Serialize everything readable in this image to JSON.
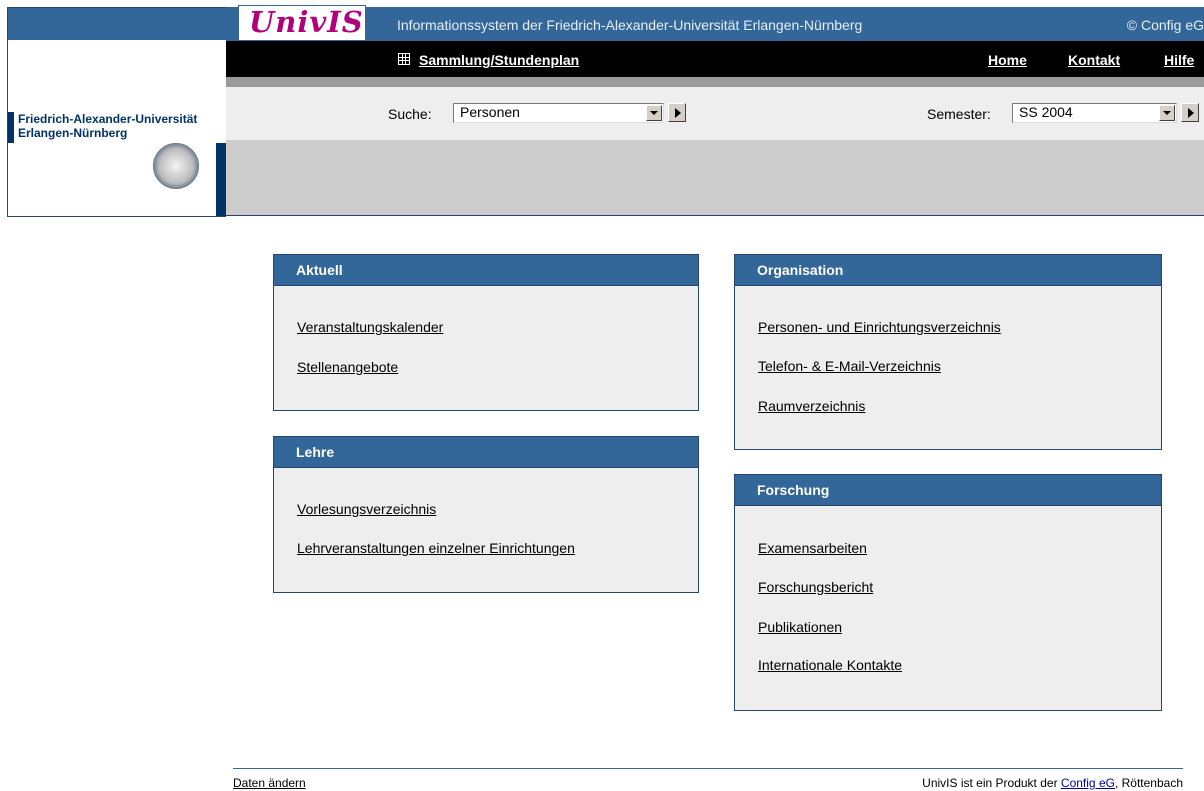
{
  "header": {
    "logo_text": "UnivIS",
    "system_title": "Informationssystem der Friedrich-Alexander-Universität Erlangen-Nürnberg",
    "copyright": "© Config eG",
    "university_line1": "Friedrich-Alexander-Universität",
    "university_line2": "Erlangen-Nürnberg"
  },
  "nav": {
    "collection_icon": "grid-icon",
    "collection_label": "Sammlung/Stundenplan",
    "home": "Home",
    "contact": "Kontakt",
    "help": "Hilfe"
  },
  "search": {
    "label": "Suche:",
    "selected": "Personen",
    "semester_label": "Semester:",
    "semester_selected": "SS 2004"
  },
  "panels": {
    "aktuell": {
      "title": "Aktuell",
      "links": [
        "Veranstaltungskalender",
        "Stellenangebote"
      ]
    },
    "lehre": {
      "title": "Lehre",
      "links": [
        "Vorlesungsverzeichnis",
        "Lehrveranstaltungen einzelner Einrichtungen"
      ]
    },
    "organisation": {
      "title": "Organisation",
      "links": [
        "Personen- und Einrichtungsverzeichnis",
        "Telefon- & E-Mail-Verzeichnis",
        "Raumverzeichnis"
      ]
    },
    "forschung": {
      "title": "Forschung",
      "links": [
        "Examensarbeiten",
        "Forschungsbericht",
        "Publikationen",
        "Internationale Kontakte"
      ]
    }
  },
  "footer": {
    "edit_data": "Daten ändern",
    "product_text": "UnivIS ist ein Produkt der",
    "company_link": "Config eG",
    "location": ", Röttenbach"
  },
  "colors": {
    "header_blue": "#336699",
    "dark_blue": "#003366",
    "logo_magenta": "#b0007a",
    "panel_bg": "#eeeeee"
  }
}
